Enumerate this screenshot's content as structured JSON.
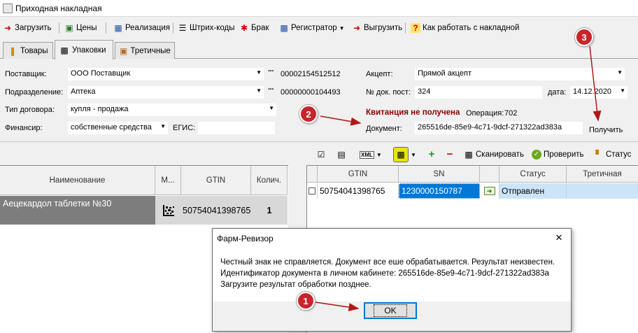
{
  "window": {
    "title": "Приходная накладная"
  },
  "toolbar": {
    "load": "Загрузить",
    "prices": "Цены",
    "sale": "Реализация",
    "barcodes": "Штрих-коды",
    "defect": "Брак",
    "registrar": "Регистратор",
    "unload": "Выгрузить",
    "help": "Как работать с накладной"
  },
  "tabs": [
    {
      "label": "Товары"
    },
    {
      "label": "Упаковки"
    },
    {
      "label": "Третичные"
    }
  ],
  "form": {
    "supplier_label": "Поставщик:",
    "supplier_value": "ООО Поставщик",
    "supplier_code": "00002154512512",
    "division_label": "Подразделение:",
    "division_value": "Аптека",
    "division_code": "00000000104493",
    "contract_label": "Тип договора:",
    "contract_value": "купля - продажа",
    "finance_label": "Финансир:",
    "finance_value": "собственные средства",
    "egis_label": "ЕГИС:",
    "egis_value": "",
    "accept_label": "Акцепт:",
    "accept_value": "Прямой акцепт",
    "docnum_label": "№ док. пост:",
    "docnum_value": "324",
    "date_label": "дата:",
    "date_value": "14.12.2020",
    "receipt_status": "Квитанция не получена",
    "operation_label": "Операция:",
    "operation_value": "702",
    "document_label": "Документ:",
    "document_value": "265516de-85e9-4c71-9dcf-271322ad383a",
    "get_button": "Получить"
  },
  "left_grid": {
    "headers": [
      "Наименование",
      "М...",
      "GTIN",
      "Колич."
    ],
    "rows": [
      {
        "name": "Аецекардол таблетки №30",
        "gtin": "50754041398765",
        "qty": "1"
      }
    ]
  },
  "right_toolbar": {
    "scan": "Сканировать",
    "check": "Проверить",
    "status": "Статус",
    "xml": "XML"
  },
  "right_grid": {
    "headers": [
      "GTIN",
      "SN",
      "Статус",
      "Третичная"
    ],
    "rows": [
      {
        "gtin": "50754041398765",
        "sn": "1230000150787",
        "status": "Отправлен",
        "tertiary": ""
      }
    ]
  },
  "dialog": {
    "title": "Фарм-Ревизор",
    "line1": "Честный знак не справляется. Документ все еше обрабатывается. Результат неизвестен.",
    "line2": "Идентификатор документа в личном кабинете: 265516de-85e9-4c71-9dcf-271322ad383a",
    "line3": "Загрузите результат обработки позднее.",
    "ok": "OK",
    "close": "✕"
  },
  "callouts": [
    "1",
    "2",
    "3"
  ],
  "colors": {
    "receipt_status": "#8b0000",
    "callout": "#c8242c",
    "arrow": "#b01818",
    "selection": "#0078d7",
    "row_dark": "#7d7d7d"
  }
}
